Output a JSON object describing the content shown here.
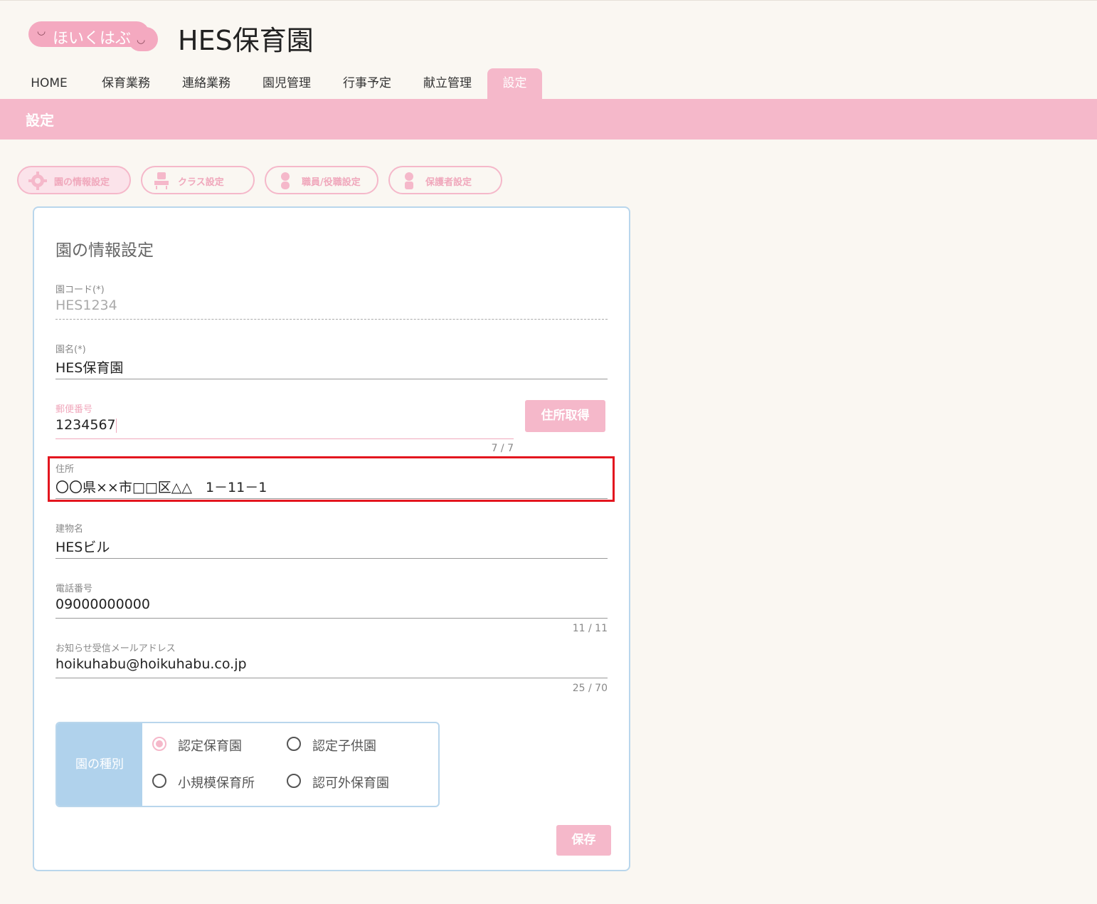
{
  "header": {
    "logo_text": "ほいくはぶ",
    "site_title": "HES保育園"
  },
  "nav": {
    "items": [
      "HOME",
      "保育業務",
      "連絡業務",
      "園児管理",
      "行事予定",
      "献立管理",
      "設定"
    ],
    "active": "設定"
  },
  "section": {
    "title": "設定"
  },
  "subtabs": [
    "園の情報設定",
    "クラス設定",
    "職員/役職設定",
    "保護者設定"
  ],
  "form": {
    "title": "園の情報設定",
    "code": {
      "label": "園コード(*)",
      "value": "HES1234"
    },
    "name": {
      "label": "園名(*)",
      "value": "HES保育園"
    },
    "postal": {
      "label": "郵便番号",
      "value": "1234567",
      "counter": "7 / 7"
    },
    "address_button": "住所取得",
    "address": {
      "label": "住所",
      "value": "〇〇県××市□□区△△　1－11－1"
    },
    "building": {
      "label": "建物名",
      "value": "HESビル"
    },
    "phone": {
      "label": "電話番号",
      "value": "09000000000",
      "counter": "11 / 11"
    },
    "email": {
      "label": "お知らせ受信メールアドレス",
      "value": "hoikuhabu@hoikuhabu.co.jp",
      "counter": "25 / 70"
    },
    "type": {
      "label": "園の種別",
      "options": [
        "認定保育園",
        "認定子供園",
        "小規模保育所",
        "認可外保育園"
      ],
      "selected": "認定保育園"
    },
    "save_button": "保存"
  },
  "colors": {
    "accent_pink": "#f5b8ca",
    "accent_blue": "#b0d2ec",
    "highlight_red": "#e3161f"
  }
}
